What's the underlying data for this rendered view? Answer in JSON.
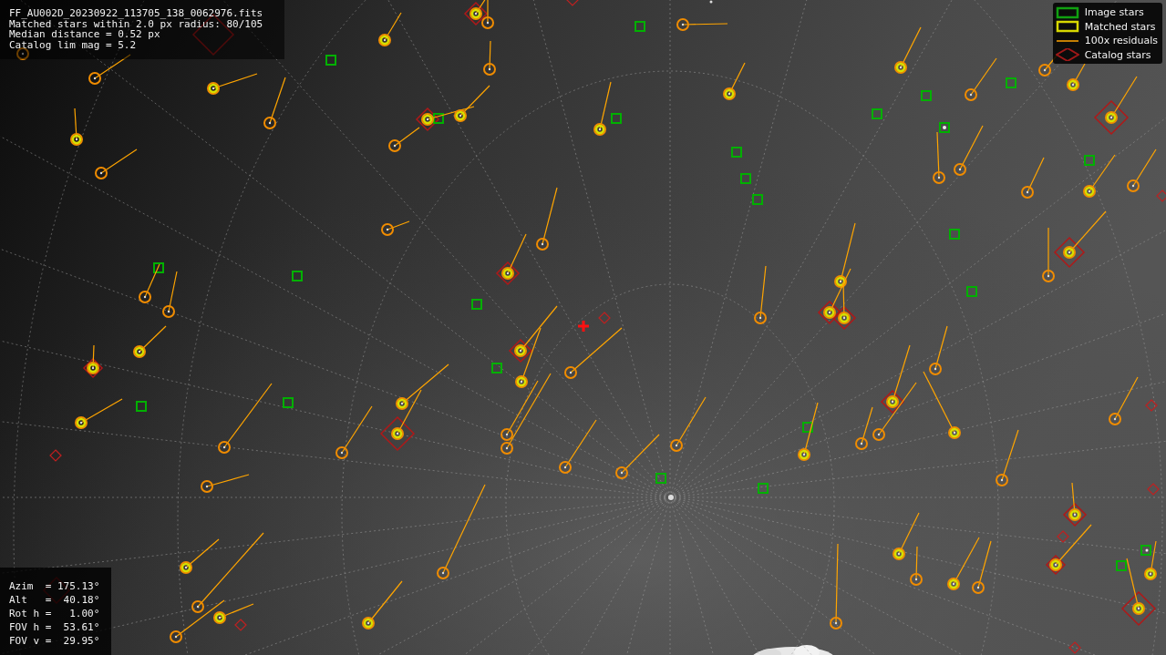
{
  "info_header": {
    "lines": [
      "FF_AU002D_20230922_113705_138_0062976.fits",
      "Matched stars within 2.0 px radius: 80/105",
      "Median distance = 0.52 px",
      "Catalog lim mag = 5.2"
    ]
  },
  "legend": [
    {
      "label": "Image stars"
    },
    {
      "kind": "matched",
      "label": "Matched stars"
    },
    {
      "kind": "residuals",
      "label": "100x residuals"
    },
    {
      "kind": "catalog",
      "label": "Catalog stars"
    }
  ],
  "pointing": {
    "lines": [
      "Azim  = 175.13°",
      "Alt   =  40.18°",
      "Rot h =   1.00°",
      "FOV h =  53.61°",
      "FOV v =  29.95°"
    ]
  }
}
